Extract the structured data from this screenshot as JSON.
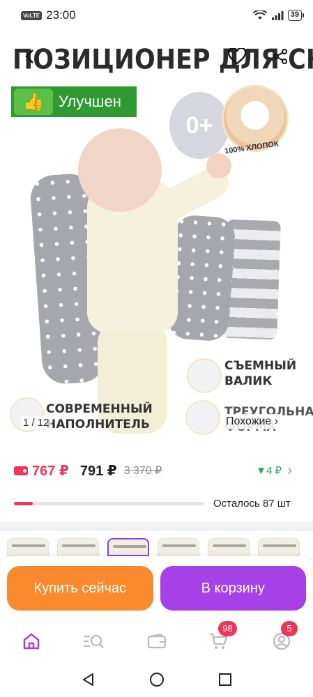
{
  "status_bar": {
    "volte": "VoLTE",
    "time": "23:00",
    "battery": "39"
  },
  "product_image": {
    "title": "ПОЗИЦИОНЕР ДЛЯ СНА",
    "improved_badge": "Улучшен",
    "age_badge": "0+",
    "cotton_label": "100% ХЛОПОК",
    "feature_removable": "СЪЕМНЫЙ ВАЛИК",
    "feature_filler": "СОВРЕМЕННЫЙ НАПОЛНИТЕЛЬ",
    "feature_triangle": "ТРЕУГОЛЬНАЯ ФОРМА",
    "counter": "1 / 12",
    "similar": "Похожие ›"
  },
  "price": {
    "card_price": "767 ₽",
    "price": "791 ₽",
    "old_price": "3 370 ₽",
    "drop": "▼4 ₽",
    "chevron": "›"
  },
  "stock": {
    "text": "Осталось 87 шт",
    "fill_fraction": 0.1
  },
  "actions": {
    "buy_now": "Купить сейчас",
    "add_to_cart": "В корзину"
  },
  "bottom_nav": {
    "cart_badge": "98",
    "profile_badge": "5"
  },
  "colors": {
    "accent_purple": "#a640e7",
    "accent_orange": "#fb8a2e",
    "price_red": "#f0345a",
    "drop_green": "#2ba35a"
  }
}
